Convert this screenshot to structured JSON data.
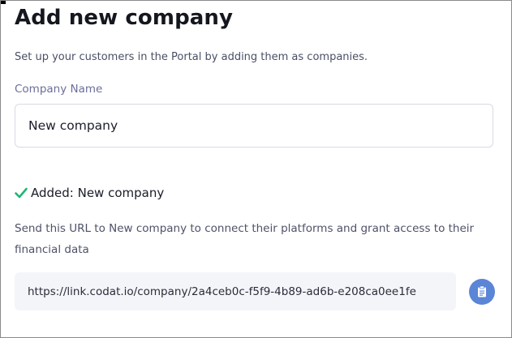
{
  "dialog": {
    "title": "Add new company",
    "subtitle": "Set up your customers in the Portal by adding them as companies."
  },
  "form": {
    "company_name_label": "Company Name",
    "company_name_value": "New company"
  },
  "result": {
    "status_icon": "checkmark-icon",
    "status_color": "#22b573",
    "added_text": "Added: New company",
    "instructions": "Send this URL to New company to connect their platforms and grant access to their financial data",
    "url": "https://link.codat.io/company/2a4ceb0c-f5f9-4b89-ad6b-e208ca0ee1fe",
    "copy_icon": "clipboard-icon",
    "copy_button_color": "#5b85d6"
  }
}
